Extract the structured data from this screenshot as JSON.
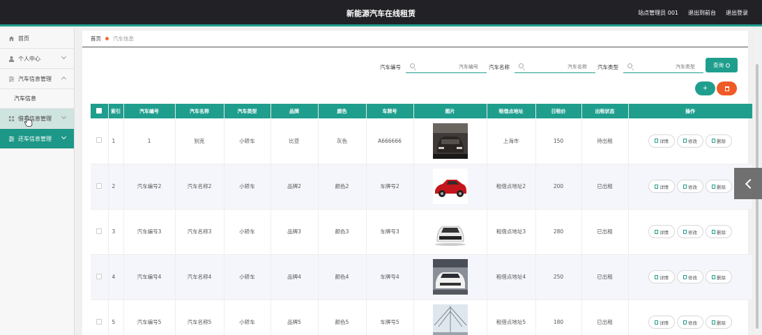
{
  "header": {
    "title": "新能源汽车在线租赁",
    "user": "站点管理员 001",
    "to_front": "退出到前台",
    "logout": "退出登录"
  },
  "sidebar": {
    "items": [
      {
        "label": "首页",
        "icon": "home-icon"
      },
      {
        "label": "个人中心",
        "icon": "user-icon"
      },
      {
        "label": "汽车信息管理",
        "icon": "sliders-icon",
        "expanded": true
      },
      {
        "label": "借车信息管理",
        "icon": "grid-icon",
        "state": "hover"
      },
      {
        "label": "还车信息管理",
        "icon": "sliders-icon",
        "state": "active"
      }
    ],
    "sub_items": [
      "汽车信息"
    ]
  },
  "breadcrumb": {
    "home": "首页",
    "current": "汽车信息"
  },
  "search": {
    "fields": [
      {
        "label": "汽车编号",
        "placeholder": "汽车编号"
      },
      {
        "label": "汽车名称",
        "placeholder": "汽车名称"
      },
      {
        "label": "汽车类型",
        "placeholder": "汽车类型"
      }
    ],
    "button": "查询"
  },
  "actions": {
    "add": "+"
  },
  "table": {
    "columns": [
      "索引",
      "汽车编号",
      "汽车名称",
      "汽车类型",
      "品牌",
      "颜色",
      "车牌号",
      "图片",
      "租借点地址",
      "日租价",
      "出租状态",
      "操作"
    ],
    "ops": {
      "detail": "详情",
      "edit": "修改",
      "delete": "删除"
    },
    "rows": [
      {
        "index": "1",
        "code": "1",
        "name": "别克",
        "type": "小轿车",
        "brand": "比亚",
        "color": "灰色",
        "plate": "A666666",
        "address": "上海市",
        "price": "150",
        "status": "待出租"
      },
      {
        "index": "2",
        "code": "汽车编号2",
        "name": "汽车名称2",
        "type": "小轿车",
        "brand": "品牌2",
        "color": "颜色2",
        "plate": "车牌号2",
        "address": "租借点地址2",
        "price": "200",
        "status": "已出租"
      },
      {
        "index": "3",
        "code": "汽车编号3",
        "name": "汽车名称3",
        "type": "小轿车",
        "brand": "品牌3",
        "color": "颜色3",
        "plate": "车牌号3",
        "address": "租借点地址3",
        "price": "280",
        "status": "已出租"
      },
      {
        "index": "4",
        "code": "汽车编号4",
        "name": "汽车名称4",
        "type": "小轿车",
        "brand": "品牌4",
        "color": "颜色4",
        "plate": "车牌号4",
        "address": "租借点地址4",
        "price": "250",
        "status": "已出租"
      },
      {
        "index": "5",
        "code": "汽车编号5",
        "name": "汽车名称5",
        "type": "小轿车",
        "brand": "品牌5",
        "color": "颜色5",
        "plate": "车牌号5",
        "address": "租借点地址5",
        "price": "180",
        "status": "已出租"
      }
    ]
  },
  "colors": {
    "accent": "#1f9e8e",
    "danger": "#f05a24",
    "header_bg": "#222226"
  }
}
